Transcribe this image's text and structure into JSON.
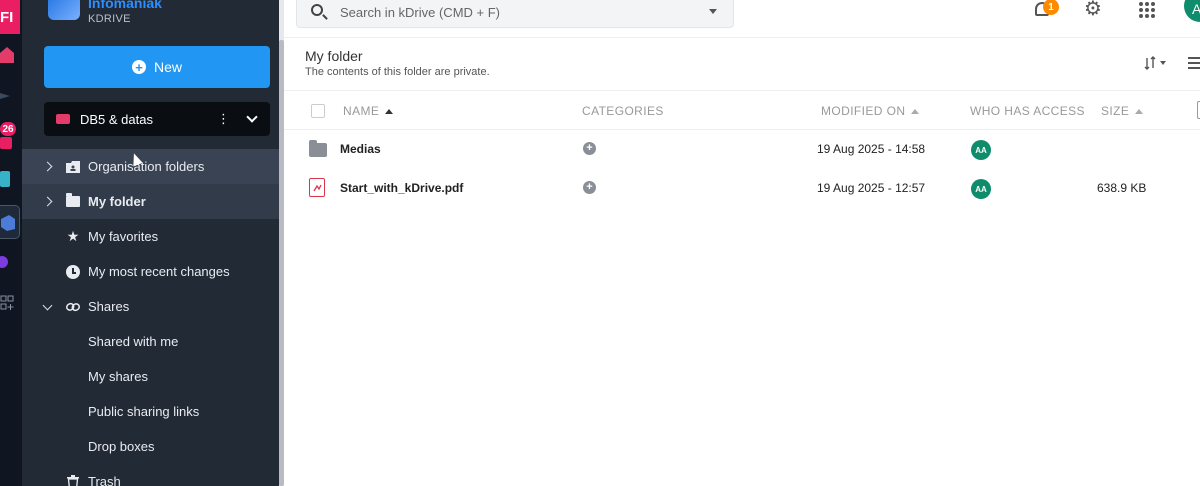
{
  "app": {
    "brand_title": "Infomaniak",
    "brand_sub": "KDRIVE",
    "rail_top_label": "FI",
    "rail_badge_count": "26"
  },
  "sidebar": {
    "new_button": "New",
    "drive": {
      "name": "DB5 & datas",
      "menu_glyph": "⋮"
    },
    "items": [
      {
        "label": "Organisation folders",
        "icon": "org-folder-icon",
        "state": "hover"
      },
      {
        "label": "My folder",
        "icon": "folder-icon",
        "state": "active"
      },
      {
        "label": "My favorites",
        "icon": "star-icon"
      },
      {
        "label": "My most recent changes",
        "icon": "clock-icon"
      },
      {
        "label": "Shares",
        "icon": "link-icon",
        "expanded": true
      },
      {
        "label": "Shared with me"
      },
      {
        "label": "My shares"
      },
      {
        "label": "Public sharing links"
      },
      {
        "label": "Drop boxes"
      },
      {
        "label": "Trash",
        "icon": "trash-icon"
      }
    ]
  },
  "topbar": {
    "search_placeholder": "Search in kDrive (CMD + F)",
    "notifications_count": "1",
    "user_initial": "A"
  },
  "main": {
    "title": "My folder",
    "subtitle": "The contents of this folder are private.",
    "columns": {
      "name": "NAME",
      "categories": "CATEGORIES",
      "modified": "MODIFIED ON",
      "access": "WHO HAS ACCESS",
      "size": "SIZE"
    },
    "rows": [
      {
        "name": "Medias",
        "type": "folder",
        "modified": "19 Aug 2025 - 14:58",
        "access": "AA",
        "size": ""
      },
      {
        "name": "Start_with_kDrive.pdf",
        "type": "pdf",
        "modified": "19 Aug 2025 - 12:57",
        "access": "AA",
        "size": "638.9 KB"
      }
    ]
  },
  "colors": {
    "sidebar_bg": "#222a36",
    "accent_blue": "#2196f3",
    "avatar_green": "#0f8c6c",
    "badge_orange": "#ff8a00",
    "rail_pink": "#e91e63"
  }
}
